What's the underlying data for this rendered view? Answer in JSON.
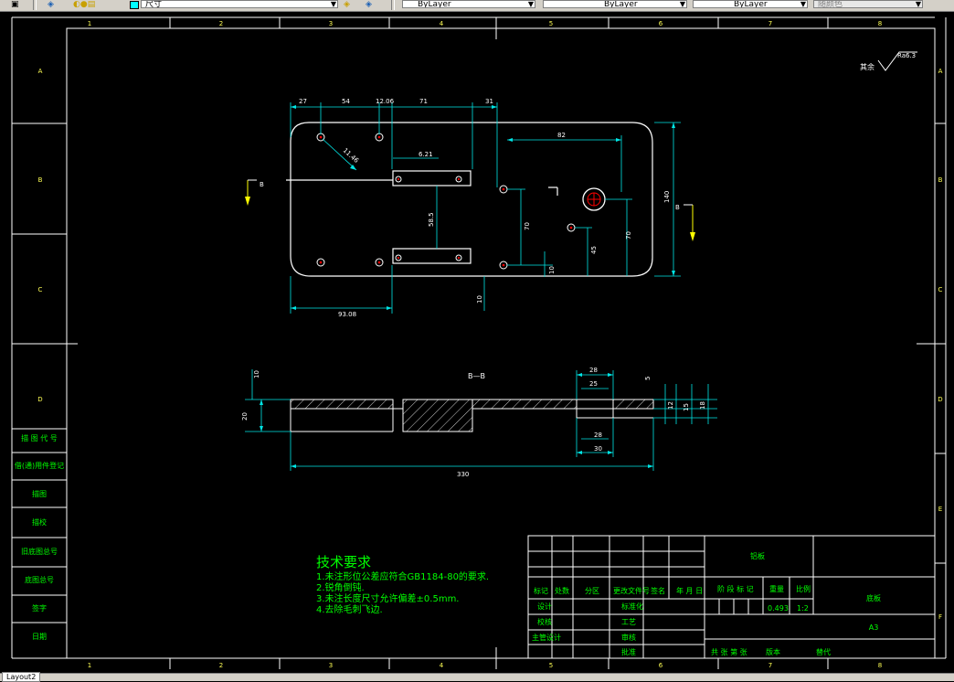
{
  "toolbar": {
    "layer_combo": "尺寸",
    "linetype_combo": "ByLayer",
    "color_combo": "ByLayer",
    "lineweight_combo": "ByLayer",
    "lineweight2_combo": "ByLayer",
    "plotstyle_combo": "随颜色"
  },
  "frame": {
    "col_labels": [
      "1",
      "2",
      "3",
      "4",
      "5",
      "6",
      "7",
      "8"
    ],
    "row_labels": [
      "A",
      "B",
      "C",
      "D",
      "E",
      "F"
    ]
  },
  "side_table": [
    "描 图 代 号",
    "借(通)用件登记",
    "描图",
    "描校",
    "旧底图总号",
    "底图总号",
    "签字",
    "日期"
  ],
  "roughness": {
    "prefix": "其余",
    "value": "Ra6.3"
  },
  "plan_view": {
    "dims_top": [
      "27",
      "54",
      "12.06",
      "71",
      "31"
    ],
    "dim_82": "82",
    "dim_621": "6.21",
    "dim_diag": "11.46",
    "dim_140": "140",
    "dim_585": "58.5",
    "dim_70a": "70",
    "dim_70b": "70",
    "dim_45": "45",
    "dim_10a": "10",
    "dim_10b": "10",
    "dim_9308": "93.08",
    "section_mark_left": "B",
    "section_mark_right": "B"
  },
  "section_view": {
    "title": "B—B",
    "dim_10": "10",
    "dim_20": "20",
    "dim_330": "330",
    "dim_28": "28",
    "dim_25": "25",
    "dim_5": "5",
    "dim_12": "12",
    "dim_15": "15",
    "dim_18": "18",
    "dim_28b": "28",
    "dim_30": "30"
  },
  "tech_req": {
    "title": "技术要求",
    "lines": [
      "1.未注形位公差应符合GB1184-80的要求.",
      "2.锐角倒钝.",
      "3.未注长度尺寸允许偏差±0.5mm.",
      "4.去除毛刺飞边."
    ]
  },
  "title_block": {
    "material": "铝板",
    "part_name": "底板",
    "sheet": "A3",
    "headers": [
      "标记",
      "处数",
      "分区",
      "更改文件号",
      "签名",
      "年 月 日"
    ],
    "stage_label": "阶 段 标 记",
    "weight_label": "重量",
    "scale_label": "比例",
    "weight_value": "0.493",
    "scale_value": "1:2",
    "roles_left": [
      "设计",
      "校核",
      "主管设计"
    ],
    "roles_mid": [
      "标准化",
      "工艺",
      "审核",
      "批准"
    ],
    "sheet_info": "共 张 第 张",
    "version": "版本",
    "replaces": "替代"
  },
  "bottom_tab": "Layout2"
}
